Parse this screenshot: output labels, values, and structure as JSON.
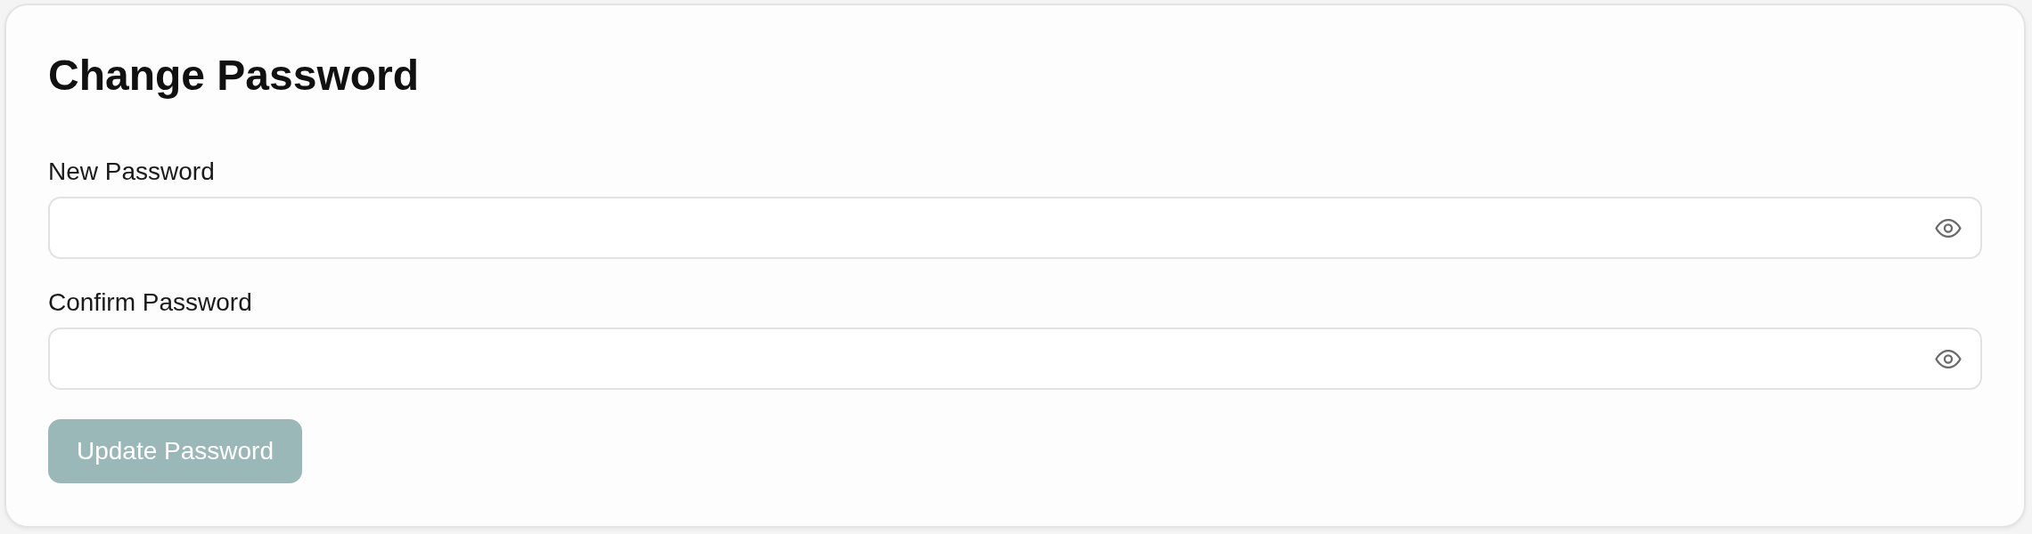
{
  "title": "Change Password",
  "fields": [
    {
      "label": "New Password"
    },
    {
      "label": "Confirm Password"
    }
  ],
  "submit_button": {
    "label": "Update Password",
    "disabled": true
  }
}
